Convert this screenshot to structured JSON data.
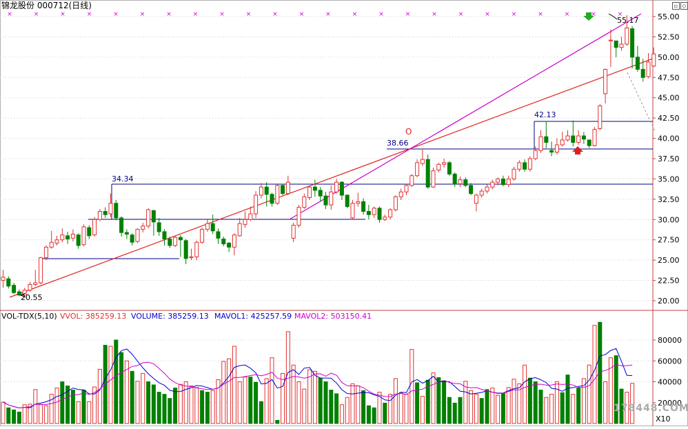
{
  "window": {
    "title": "锦龙股份 000712(日线)"
  },
  "price_axis": {
    "ticks": [
      "55.00",
      "52.50",
      "50.00",
      "47.50",
      "45.00",
      "42.50",
      "40.00",
      "37.50",
      "35.00",
      "32.50",
      "30.00",
      "27.50",
      "25.00",
      "22.50",
      "20.00"
    ]
  },
  "annotations": {
    "low": "20.55",
    "high": "55.17",
    "level1": "34.34",
    "level2": "38.66",
    "level3": "42.13",
    "circle_mark": "O"
  },
  "indicator": {
    "name": "VOL-TDX(5,10)",
    "vvol": "VVOL: 385259.13",
    "volume": "VOLUME: 385259.13",
    "mavol1": "MAVOL1: 425257.59",
    "mavol2": "MAVOL2: 503150.41"
  },
  "volume_axis": {
    "ticks": [
      "80000",
      "60000",
      "40000",
      "20000"
    ],
    "unit": "X10"
  },
  "watermark": "178448.COM",
  "colors": {
    "up": "#e03030",
    "down": "#008000",
    "ma1": "#0000cc",
    "ma2": "#cc00cc",
    "trend": "#e02020",
    "hline": "#000080"
  },
  "chart_data": {
    "type": "candlestick",
    "candles": [
      [
        22.5,
        22.9,
        21.6,
        23.8
      ],
      [
        22.7,
        21.8,
        21.5,
        23.0
      ],
      [
        21.9,
        21.0,
        20.8,
        22.2
      ],
      [
        21.1,
        20.7,
        20.55,
        21.4
      ],
      [
        20.7,
        21.3,
        20.6,
        21.6
      ],
      [
        21.3,
        22.0,
        21.1,
        22.3
      ],
      [
        22.0,
        22.2,
        21.8,
        23.8
      ],
      [
        22.2,
        25.3,
        22.0,
        25.4
      ],
      [
        25.3,
        26.6,
        25.0,
        26.8
      ],
      [
        26.6,
        27.2,
        26.4,
        28.6
      ],
      [
        27.1,
        27.5,
        26.8,
        28.0
      ],
      [
        27.5,
        28.1,
        27.2,
        28.9
      ],
      [
        28.0,
        27.6,
        27.0,
        28.5
      ],
      [
        27.7,
        28.2,
        27.3,
        28.8
      ],
      [
        28.1,
        26.8,
        26.4,
        28.3
      ],
      [
        26.9,
        29.1,
        26.7,
        29.4
      ],
      [
        29.0,
        28.0,
        27.6,
        29.3
      ],
      [
        28.1,
        30.0,
        27.9,
        30.3
      ],
      [
        30.0,
        31.0,
        29.8,
        31.3
      ],
      [
        31.0,
        30.6,
        30.2,
        31.5
      ],
      [
        30.7,
        32.0,
        30.3,
        33.2
      ],
      [
        32.0,
        30.2,
        29.9,
        32.4
      ],
      [
        30.2,
        28.4,
        27.9,
        30.4
      ],
      [
        28.4,
        28.2,
        27.6,
        28.8
      ],
      [
        28.1,
        27.2,
        26.8,
        28.3
      ],
      [
        27.3,
        28.8,
        27.1,
        28.9
      ],
      [
        28.8,
        29.2,
        28.4,
        29.6
      ],
      [
        29.2,
        31.2,
        28.9,
        31.4
      ],
      [
        31.1,
        29.7,
        28.0,
        31.2
      ],
      [
        29.6,
        28.5,
        28.0,
        30.2
      ],
      [
        28.5,
        27.6,
        26.8,
        28.8
      ],
      [
        27.6,
        26.8,
        26.5,
        27.9
      ],
      [
        26.8,
        27.8,
        26.6,
        28.0
      ],
      [
        27.8,
        27.5,
        25.4,
        28.1
      ],
      [
        27.4,
        25.2,
        24.5,
        27.6
      ],
      [
        25.3,
        25.4,
        25.0,
        26.4
      ],
      [
        25.4,
        27.2,
        25.0,
        27.4
      ],
      [
        27.2,
        28.8,
        27.0,
        29.0
      ],
      [
        28.8,
        29.5,
        28.5,
        30.0
      ],
      [
        29.5,
        28.6,
        28.2,
        30.6
      ],
      [
        28.5,
        27.7,
        27.0,
        28.9
      ],
      [
        27.6,
        27.0,
        26.7,
        27.9
      ],
      [
        27.1,
        26.6,
        26.0,
        27.2
      ],
      [
        26.6,
        28.1,
        25.6,
        28.3
      ],
      [
        28.0,
        29.5,
        27.9,
        30.2
      ],
      [
        29.4,
        30.0,
        29.0,
        31.0
      ],
      [
        30.0,
        30.7,
        29.8,
        31.6
      ],
      [
        30.7,
        33.0,
        30.2,
        33.5
      ],
      [
        33.0,
        34.0,
        32.6,
        34.5
      ],
      [
        34.0,
        33.1,
        31.6,
        34.6
      ],
      [
        33.1,
        32.0,
        31.6,
        33.3
      ],
      [
        32.0,
        34.2,
        31.8,
        34.3
      ],
      [
        34.2,
        33.2,
        33.0,
        34.4
      ],
      [
        33.2,
        34.6,
        33.0,
        35.4
      ],
      [
        27.7,
        29.3,
        27.2,
        29.6
      ],
      [
        29.3,
        31.5,
        29.0,
        31.8
      ],
      [
        31.5,
        32.8,
        31.3,
        33.2
      ],
      [
        32.7,
        34.0,
        32.4,
        34.2
      ],
      [
        34.0,
        33.6,
        32.8,
        34.9
      ],
      [
        33.6,
        32.9,
        32.2,
        34.0
      ],
      [
        32.9,
        31.8,
        31.3,
        33.4
      ],
      [
        31.8,
        33.4,
        31.2,
        34.2
      ],
      [
        33.4,
        34.6,
        33.2,
        35.0
      ],
      [
        34.6,
        33.0,
        32.4,
        34.7
      ],
      [
        33.0,
        31.6,
        31.4,
        33.1
      ],
      [
        30.2,
        32.0,
        30.0,
        32.4
      ],
      [
        32.0,
        32.2,
        31.6,
        33.3
      ],
      [
        32.2,
        31.0,
        30.6,
        32.6
      ],
      [
        31.0,
        30.6,
        30.0,
        31.8
      ],
      [
        30.6,
        31.4,
        30.2,
        31.6
      ],
      [
        31.4,
        30.0,
        29.6,
        31.6
      ],
      [
        30.0,
        30.3,
        29.8,
        30.6
      ],
      [
        30.3,
        31.2,
        30.0,
        31.4
      ],
      [
        31.2,
        32.8,
        31.0,
        33.0
      ],
      [
        32.8,
        33.4,
        32.4,
        33.8
      ],
      [
        33.4,
        34.2,
        33.0,
        34.4
      ],
      [
        34.2,
        35.4,
        34.0,
        35.6
      ],
      [
        35.4,
        37.0,
        35.2,
        37.4
      ],
      [
        36.9,
        37.4,
        36.6,
        38.6
      ],
      [
        37.4,
        34.0,
        33.8,
        38.0
      ],
      [
        34.0,
        36.0,
        33.9,
        36.4
      ],
      [
        36.1,
        36.8,
        35.8,
        37.0
      ],
      [
        36.8,
        37.0,
        36.4,
        37.5
      ],
      [
        37.0,
        35.6,
        35.4,
        37.2
      ],
      [
        35.6,
        34.4,
        34.0,
        35.8
      ],
      [
        34.4,
        34.9,
        34.0,
        35.3
      ],
      [
        34.9,
        34.2,
        34.0,
        35.2
      ],
      [
        34.2,
        33.2,
        33.0,
        34.5
      ],
      [
        32.0,
        33.0,
        31.0,
        33.2
      ],
      [
        33.0,
        33.5,
        32.7,
        33.8
      ],
      [
        33.5,
        34.0,
        33.2,
        34.3
      ],
      [
        34.0,
        34.6,
        33.7,
        34.9
      ],
      [
        34.6,
        35.0,
        34.2,
        35.2
      ],
      [
        35.0,
        34.3,
        34.1,
        35.4
      ],
      [
        34.3,
        35.0,
        34.0,
        35.4
      ],
      [
        35.0,
        36.2,
        34.8,
        36.5
      ],
      [
        36.2,
        37.0,
        35.9,
        37.3
      ],
      [
        37.0,
        36.2,
        35.9,
        37.4
      ],
      [
        36.2,
        37.5,
        35.9,
        37.8
      ],
      [
        37.5,
        38.5,
        37.3,
        39.0
      ],
      [
        38.5,
        40.2,
        38.2,
        41.0
      ],
      [
        40.2,
        39.5,
        38.8,
        42.13
      ],
      [
        38.5,
        38.3,
        37.8,
        39.6
      ],
      [
        38.3,
        39.2,
        38.0,
        40.0
      ],
      [
        39.2,
        39.8,
        39.0,
        40.8
      ],
      [
        39.8,
        40.3,
        39.6,
        41.0
      ],
      [
        40.3,
        39.5,
        39.0,
        42.2
      ],
      [
        39.5,
        40.3,
        39.2,
        41.0
      ],
      [
        40.3,
        39.9,
        39.3,
        40.8
      ],
      [
        39.8,
        39.1,
        38.8,
        39.8
      ],
      [
        39.1,
        41.1,
        39.0,
        41.4
      ],
      [
        41.2,
        44.0,
        41.0,
        44.2
      ],
      [
        45.5,
        48.5,
        44.3,
        48.6
      ],
      [
        52.0,
        52.1,
        48.8,
        53.4
      ],
      [
        52.0,
        51.2,
        50.0,
        52.0
      ],
      [
        51.2,
        51.6,
        50.8,
        52.5
      ],
      [
        51.6,
        53.6,
        51.4,
        55.17
      ],
      [
        53.5,
        50.0,
        48.6,
        53.8
      ],
      [
        50.0,
        48.5,
        48.2,
        51.4
      ],
      [
        48.5,
        47.5,
        47.0,
        49.8
      ],
      [
        47.6,
        49.4,
        47.4,
        50.5
      ],
      [
        48.9,
        50.4,
        48.8,
        51.2
      ]
    ],
    "volume": [
      [
        20500,
        1
      ],
      [
        15000,
        0
      ],
      [
        13000,
        0
      ],
      [
        11000,
        0
      ],
      [
        18000,
        1
      ],
      [
        18500,
        1
      ],
      [
        32500,
        1
      ],
      [
        18000,
        1
      ],
      [
        17000,
        1
      ],
      [
        28000,
        1
      ],
      [
        34000,
        1
      ],
      [
        40000,
        0
      ],
      [
        36000,
        0
      ],
      [
        32000,
        0
      ],
      [
        21000,
        1
      ],
      [
        32000,
        0
      ],
      [
        21000,
        1
      ],
      [
        35000,
        1
      ],
      [
        52000,
        1
      ],
      [
        75000,
        0
      ],
      [
        74000,
        1
      ],
      [
        80000,
        0
      ],
      [
        68000,
        0
      ],
      [
        60000,
        1
      ],
      [
        50000,
        0
      ],
      [
        40500,
        1
      ],
      [
        48000,
        1
      ],
      [
        40000,
        0
      ],
      [
        37000,
        0
      ],
      [
        30000,
        0
      ],
      [
        28000,
        0
      ],
      [
        24000,
        0
      ],
      [
        34000,
        0
      ],
      [
        37500,
        1
      ],
      [
        40000,
        1
      ],
      [
        36000,
        1
      ],
      [
        34500,
        1
      ],
      [
        31500,
        0
      ],
      [
        30000,
        0
      ],
      [
        31500,
        1
      ],
      [
        42000,
        1
      ],
      [
        59500,
        1
      ],
      [
        62000,
        1
      ],
      [
        74000,
        1
      ],
      [
        40000,
        1
      ],
      [
        44500,
        1
      ],
      [
        44500,
        0
      ],
      [
        39500,
        0
      ],
      [
        21000,
        0
      ],
      [
        43000,
        1
      ],
      [
        63000,
        1
      ],
      [
        3000,
        0
      ],
      [
        48000,
        1
      ],
      [
        88000,
        1
      ],
      [
        56000,
        1
      ],
      [
        40000,
        1
      ],
      [
        33000,
        1
      ],
      [
        51500,
        1
      ],
      [
        50000,
        1
      ],
      [
        43500,
        0
      ],
      [
        40000,
        0
      ],
      [
        32000,
        0
      ],
      [
        28500,
        0
      ],
      [
        18000,
        1
      ],
      [
        25000,
        1
      ],
      [
        38000,
        1
      ],
      [
        36000,
        1
      ],
      [
        31500,
        0
      ],
      [
        17000,
        0
      ],
      [
        15000,
        0
      ],
      [
        30000,
        1
      ],
      [
        19500,
        0
      ],
      [
        28000,
        1
      ],
      [
        43000,
        1
      ],
      [
        29500,
        1
      ],
      [
        28000,
        1
      ],
      [
        71000,
        1
      ],
      [
        39000,
        0
      ],
      [
        26000,
        1
      ],
      [
        41500,
        0
      ],
      [
        48500,
        1
      ],
      [
        44000,
        0
      ],
      [
        41000,
        0
      ],
      [
        25000,
        0
      ],
      [
        19500,
        0
      ],
      [
        25000,
        0
      ],
      [
        40500,
        1
      ],
      [
        31500,
        1
      ],
      [
        28000,
        1
      ],
      [
        24000,
        0
      ],
      [
        32500,
        0
      ],
      [
        34000,
        1
      ],
      [
        27000,
        1
      ],
      [
        29000,
        0
      ],
      [
        34500,
        1
      ],
      [
        42500,
        1
      ],
      [
        38000,
        1
      ],
      [
        56000,
        1
      ],
      [
        43500,
        0
      ],
      [
        40000,
        0
      ],
      [
        32000,
        0
      ],
      [
        25000,
        1
      ],
      [
        28000,
        1
      ],
      [
        40000,
        1
      ],
      [
        29500,
        0
      ],
      [
        46500,
        0
      ],
      [
        28000,
        1
      ],
      [
        34000,
        0
      ],
      [
        43000,
        1
      ],
      [
        56000,
        1
      ],
      [
        94000,
        1
      ],
      [
        97000,
        0
      ],
      [
        40000,
        1
      ],
      [
        63000,
        1
      ],
      [
        65000,
        0
      ],
      [
        33000,
        0
      ],
      [
        30000,
        1
      ],
      [
        38500,
        1
      ]
    ]
  }
}
